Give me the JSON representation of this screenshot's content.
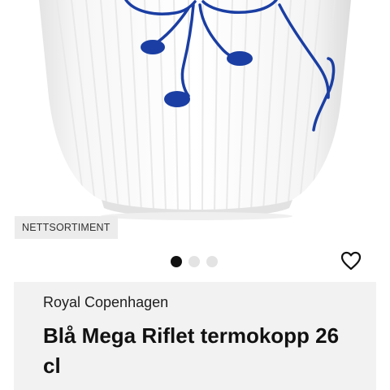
{
  "product": {
    "image_alt": "Blå Mega Riflet termokopp",
    "badge": "NETTSORTIMENT",
    "brand": "Royal Copenhagen",
    "title": "Blå Mega Riflet termokopp 26 cl"
  },
  "gallery": {
    "total_images": 3,
    "active_index": 1
  },
  "icons": {
    "favorite": "heart-outline-icon"
  },
  "colors": {
    "pattern_blue": "#1a3ea3",
    "badge_bg": "#ececec",
    "card_bg": "#f2f2f2",
    "dot_active": "#111111",
    "dot_inactive": "#e3e3e3"
  }
}
